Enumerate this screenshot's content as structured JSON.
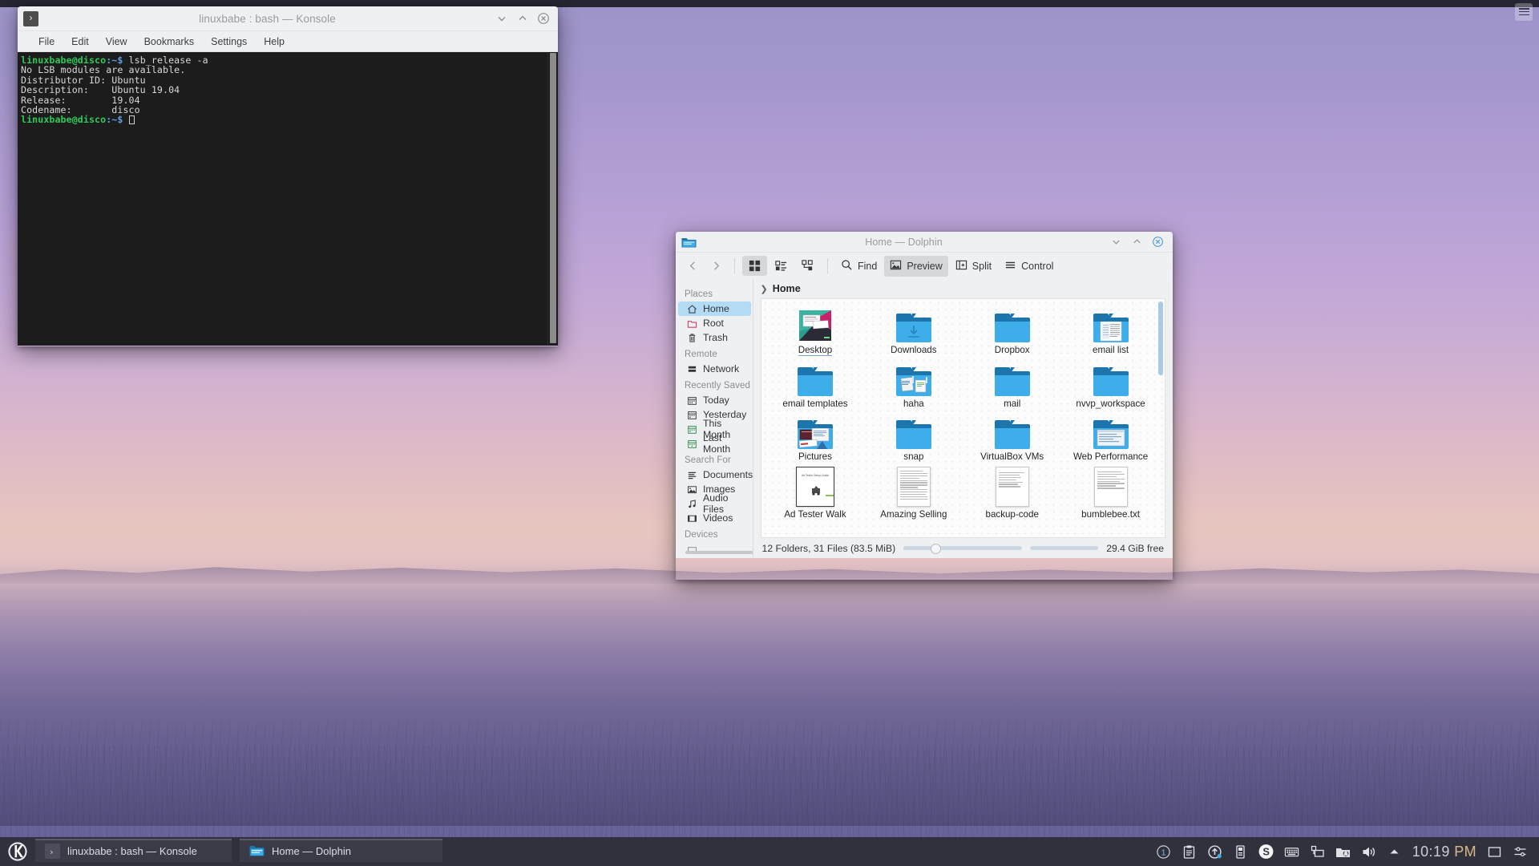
{
  "desktop": {
    "wallpaper_description": "KDE Plasma lake sunset wallpaper, purple and pink gradient sky",
    "toolbox_name": "desktop-toolbox"
  },
  "konsole": {
    "title": "linuxbabe : bash — Konsole",
    "app_icon": "terminal-icon",
    "menus": [
      "File",
      "Edit",
      "View",
      "Bookmarks",
      "Settings",
      "Help"
    ],
    "window_buttons": [
      "minimize",
      "maximize",
      "close"
    ],
    "terminal": {
      "prompt_user": "linuxbabe@disco",
      "prompt_path": ":~$",
      "command": "lsb_release -a",
      "output": [
        "No LSB modules are available.",
        "Distributor ID:\tUbuntu",
        "Description:\tUbuntu 19.04",
        "Release:\t19.04",
        "Codename:\tdisco"
      ],
      "output_lines_plain": [
        "No LSB modules are available.",
        "Distributor ID: Ubuntu",
        "Description:    Ubuntu 19.04",
        "Release:        19.04",
        "Codename:       disco"
      ]
    }
  },
  "dolphin": {
    "title": "Home — Dolphin",
    "app_icon": "folder-icon",
    "window_buttons": [
      "minimize",
      "maximize",
      "close"
    ],
    "toolbar": {
      "back_label": "Back",
      "forward_label": "Forward",
      "view_icons_label": "Icons",
      "view_compact_label": "Compact",
      "view_details_label": "Details",
      "find_label": "Find",
      "preview_label": "Preview",
      "split_label": "Split",
      "control_label": "Control",
      "active_view": "Icons",
      "preview_active": true
    },
    "breadcrumb": "Home",
    "places": {
      "groups": [
        {
          "title": "Places",
          "items": [
            {
              "label": "Home",
              "icon": "home-icon",
              "selected": true
            },
            {
              "label": "Root",
              "icon": "root-folder-icon",
              "selected": false
            },
            {
              "label": "Trash",
              "icon": "trash-icon",
              "selected": false
            }
          ]
        },
        {
          "title": "Remote",
          "items": [
            {
              "label": "Network",
              "icon": "network-icon",
              "selected": false
            }
          ]
        },
        {
          "title": "Recently Saved",
          "items": [
            {
              "label": "Today",
              "icon": "calendar-icon",
              "selected": false
            },
            {
              "label": "Yesterday",
              "icon": "calendar-icon",
              "selected": false
            },
            {
              "label": "This Month",
              "icon": "calendar-icon",
              "selected": false
            },
            {
              "label": "Last Month",
              "icon": "calendar-icon",
              "selected": false
            }
          ]
        },
        {
          "title": "Search For",
          "items": [
            {
              "label": "Documents",
              "icon": "documents-icon",
              "selected": false
            },
            {
              "label": "Images",
              "icon": "images-icon",
              "selected": false
            },
            {
              "label": "Audio Files",
              "icon": "audio-icon",
              "selected": false
            },
            {
              "label": "Videos",
              "icon": "video-icon",
              "selected": false
            }
          ]
        },
        {
          "title": "Devices",
          "items": []
        }
      ]
    },
    "files": [
      {
        "name": "Desktop",
        "type": "folder-preview-wallpaper",
        "first": true
      },
      {
        "name": "Downloads",
        "type": "folder-download"
      },
      {
        "name": "Dropbox",
        "type": "folder"
      },
      {
        "name": "email list",
        "type": "folder-preview-doc"
      },
      {
        "name": "email templates",
        "type": "folder"
      },
      {
        "name": "haha",
        "type": "folder-preview-screens"
      },
      {
        "name": "mail",
        "type": "folder"
      },
      {
        "name": "nvvp_workspace",
        "type": "folder"
      },
      {
        "name": "Pictures",
        "type": "folder-preview-pics"
      },
      {
        "name": "snap",
        "type": "folder"
      },
      {
        "name": "VirtualBox VMs",
        "type": "folder"
      },
      {
        "name": "Web Performance",
        "type": "folder-preview-web"
      },
      {
        "name": "Ad Tester Walk",
        "type": "document-preview",
        "doc_title": "Ad Tester Setup Guide"
      },
      {
        "name": "Amazing Selling",
        "type": "document-text"
      },
      {
        "name": "backup-code",
        "type": "document-text"
      },
      {
        "name": "bumblebee.txt",
        "type": "document-text"
      }
    ],
    "statusbar": {
      "summary": "12 Folders, 31 Files (83.5 MiB)",
      "free_space": "29.4 GiB free",
      "zoom_value": 25
    }
  },
  "taskbar": {
    "launcher_name": "kde-application-launcher",
    "tasks": [
      {
        "label": "linuxbabe : bash — Konsole",
        "icon": "terminal-icon"
      },
      {
        "label": "Home — Dolphin",
        "icon": "folder-icon"
      }
    ],
    "tray_icons": [
      "notifications-icon",
      "clipboard-icon",
      "updates-icon",
      "usb-device-icon",
      "skype-icon",
      "keyboard-layout-icon",
      "network-icon",
      "cloud-sync-icon",
      "volume-icon",
      "show-hidden-icons-arrow"
    ],
    "clock_time": "10:19",
    "clock_ampm": "PM",
    "right_icons": [
      "show-desktop-icon",
      "panel-settings-icon"
    ]
  },
  "colors": {
    "accent": "#3daee9",
    "selection": "#b3dcf4",
    "panel": "#31313e",
    "window_bg": "#eff0f1",
    "terminal_bg": "#1b1c1b",
    "terminal_green": "#2ec95a"
  }
}
